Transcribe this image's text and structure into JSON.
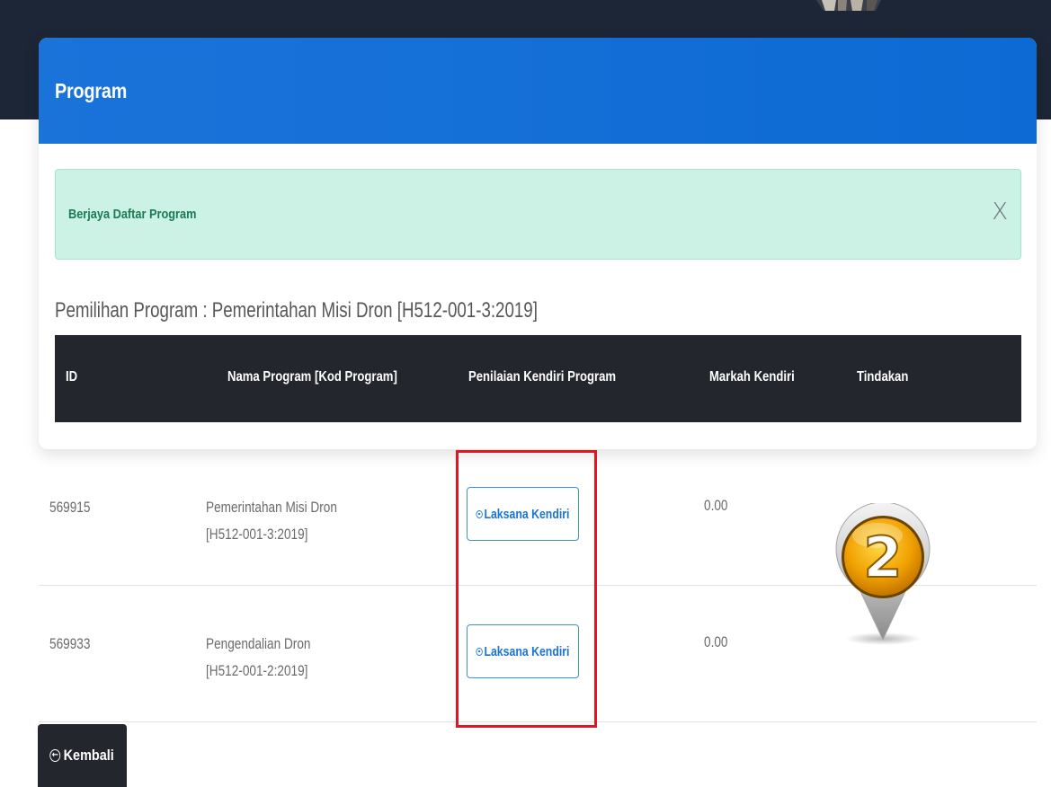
{
  "card": {
    "title": "Program"
  },
  "alert": {
    "message": "Berjaya Daftar Program",
    "close_label": "X"
  },
  "selection": {
    "text": "Pemilihan Program : Pemerintahan Misi Dron [H512-001-3:2019]"
  },
  "table": {
    "headers": {
      "id": "ID",
      "name": "Nama Program [Kod Program]",
      "assessment": "Penilaian Kendiri Program",
      "score": "Markah Kendiri",
      "action": "Tindakan"
    },
    "rows": [
      {
        "id": "569915",
        "name": "Pemerintahan Misi Dron",
        "code": "[H512-001-3:2019]",
        "button": "Laksana Kendiri",
        "score": "0.00"
      },
      {
        "id": "569933",
        "name": "Pengendalian Dron",
        "code": "[H512-001-2:2019]",
        "button": "Laksana Kendiri",
        "score": "0.00"
      }
    ]
  },
  "footer": {
    "back_label": "Kembali"
  },
  "overlay": {
    "step_number": "2"
  },
  "colors": {
    "header_blue": "#1a73d9",
    "topbar": "#1d2636",
    "alert_bg": "#ccf2e6",
    "alert_text": "#1b7b55",
    "table_head": "#23262d",
    "highlight_red": "#e8131e",
    "badge_gold": "#f0a000"
  },
  "icons": {
    "laksana": "radio-dot-icon",
    "back": "circle-arrow-left-icon",
    "close": "close-icon",
    "marker": "map-pin-icon"
  }
}
